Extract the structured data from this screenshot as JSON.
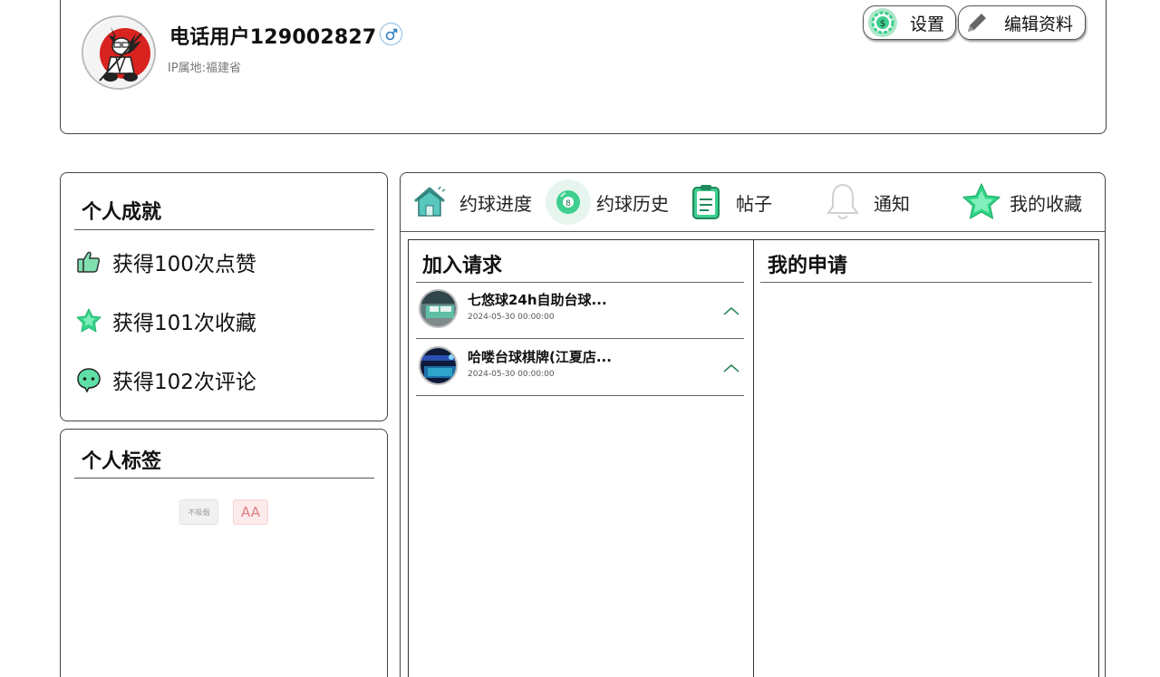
{
  "profile": {
    "username": "电话用户129002827",
    "gender_symbol": "♂",
    "ip_location": "IP属地:福建省",
    "settings_label": "设置",
    "edit_label": "编辑资料"
  },
  "achievements": {
    "title": "个人成就",
    "items": [
      {
        "label": "获得100次点赞",
        "icon": "thumbs-up-icon"
      },
      {
        "label": "获得101次收藏",
        "icon": "star-icon"
      },
      {
        "label": "获得102次评论",
        "icon": "comment-icon"
      }
    ]
  },
  "tags": {
    "title": "个人标签",
    "items": [
      "不吸烟",
      "AA"
    ]
  },
  "tabs": [
    {
      "label": "约球进度",
      "icon": "house-icon"
    },
    {
      "label": "约球历史",
      "icon": "billiard-ball-icon"
    },
    {
      "label": "帖子",
      "icon": "clipboard-icon"
    },
    {
      "label": "通知",
      "icon": "bell-icon"
    },
    {
      "label": "我的收藏",
      "icon": "star-icon"
    }
  ],
  "join_requests": {
    "title": "加入请求",
    "items": [
      {
        "name": "七悠球24h自助台球...",
        "date": "2024-05-30 00:00:00"
      },
      {
        "name": "哈喽台球棋牌(江夏店...",
        "date": "2024-05-30 00:00:00"
      }
    ]
  },
  "my_applications": {
    "title": "我的申请"
  },
  "colors": {
    "accent_green": "#3ecf8e",
    "border": "#444444"
  }
}
